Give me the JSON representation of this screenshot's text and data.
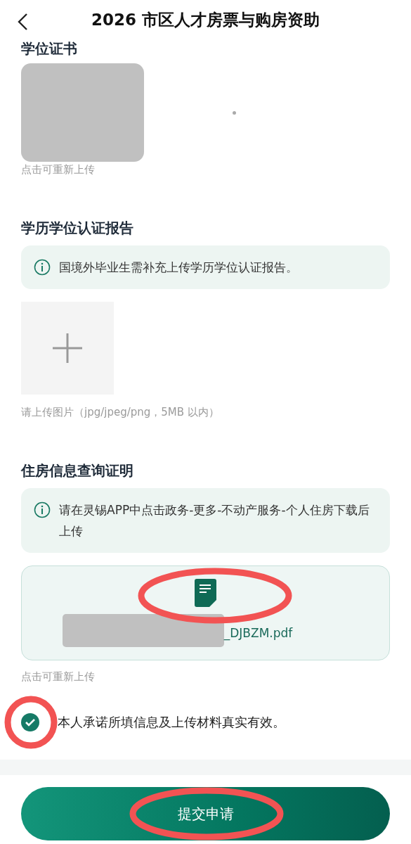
{
  "header": {
    "title": "2026 市区人才房票与购房资助"
  },
  "sections": [
    {
      "kind": "image",
      "title": "学位证书",
      "hint": "点击可重新上传"
    },
    {
      "kind": "upload",
      "title": "学历学位认证报告",
      "notice": "国境外毕业生需补充上传学历学位认证报告。",
      "hint": "请上传图片（jpg/jpeg/png，5MB 以内）"
    },
    {
      "kind": "file",
      "title": "住房信息查询证明",
      "notice": "请在灵锡APP中点击政务-更多-不动产服务-个人住房下载后上传",
      "file_name": "_DJBZM.pdf",
      "hint": "点击可重新上传"
    }
  ],
  "agreement": {
    "text": "本人承诺所填信息及上传材料真实有效。",
    "checked": true
  },
  "submit": {
    "label": "提交申请"
  }
}
